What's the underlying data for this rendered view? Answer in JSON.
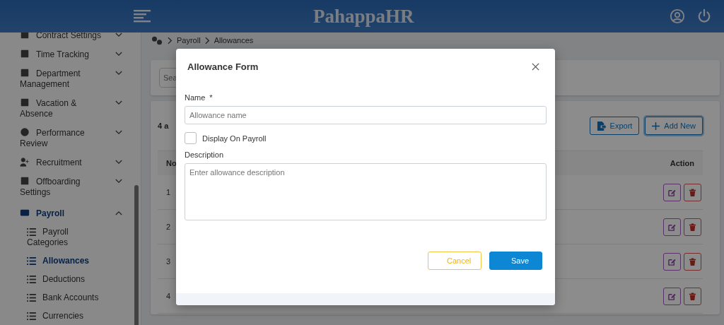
{
  "header": {
    "logo": "PahappaHR"
  },
  "sidebar": {
    "items": [
      {
        "label": "Contract Settings",
        "expanded": false
      },
      {
        "label": "Time Tracking",
        "expanded": false
      },
      {
        "label": "Department Management",
        "expanded": false
      },
      {
        "label": "Vacation & Absence",
        "expanded": false
      },
      {
        "label": "Performance Review",
        "expanded": false
      },
      {
        "label": "Recruitment",
        "expanded": false
      },
      {
        "label": "Offboarding Settings",
        "expanded": false
      },
      {
        "label": "Payroll",
        "expanded": true,
        "children": [
          {
            "label": "Payroll Categories",
            "selected": false
          },
          {
            "label": "Allowances",
            "selected": true
          },
          {
            "label": "Deductions",
            "selected": false
          },
          {
            "label": "Bank Accounts",
            "selected": false
          },
          {
            "label": "Currencies",
            "selected": false
          }
        ]
      }
    ]
  },
  "breadcrumb": [
    "Payroll",
    "Allowances"
  ],
  "search": {
    "placeholder": "Sea"
  },
  "table": {
    "count": "4 a",
    "buttons": [
      "Export",
      "Add New"
    ],
    "columns": [
      "No",
      "Action"
    ],
    "rows": [
      "1",
      "2",
      "3",
      "4"
    ]
  },
  "modal": {
    "title": "Allowance Form",
    "name_label": "Name",
    "required_mark": "*",
    "name_placeholder": "Allowance name",
    "checkbox": {
      "label": "Display On Payroll",
      "checked": false
    },
    "description_label": "Description",
    "description_placeholder": "Enter allowance description",
    "cancel": "Cancel",
    "save": "Save"
  }
}
